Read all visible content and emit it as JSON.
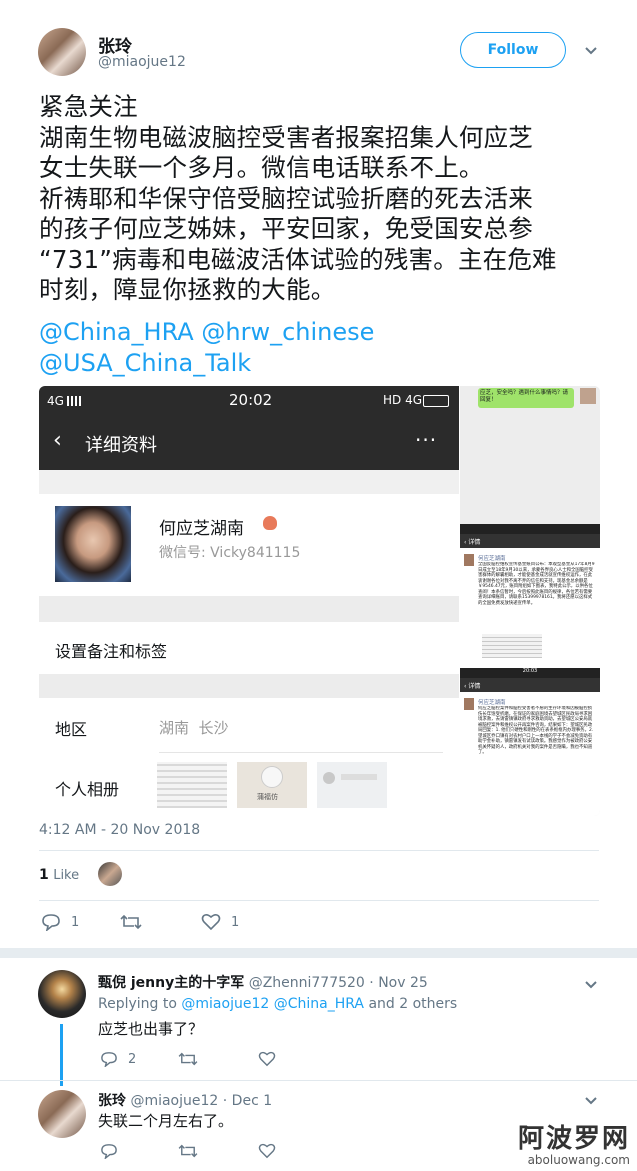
{
  "tweet": {
    "author_name": "张玲",
    "author_handle": "@miaojue12",
    "follow_label": "Follow",
    "text": "紧急关注\n湖南生物电磁波脑控受害者报案招集人何应芝\n女士失联一个多月。微信电话联系不上。\n祈祷耶和华保守倍受脑控试验折磨的死去活来\n的孩子何应芝姊妹，平安回家，免受国安总参\n“731”病毒和电磁波活体试验的残害。主在危难\n时刻，障显你拯救的大能。",
    "mentions": [
      "@China_HRA",
      "@hrw_chinese",
      "@USA_China_Talk"
    ],
    "timestamp": "4:12 AM - 20 Nov 2018",
    "likes_count": "1",
    "likes_label": "Like",
    "actions": {
      "reply_count": "1",
      "retweet_count": "",
      "like_count": "1"
    }
  },
  "screenshot_main": {
    "carrier": "4G",
    "time": "20:02",
    "status_right": "HD 4G",
    "nav_title": "详细资料",
    "contact_name": "何应芝湖南",
    "wechat_id": "微信号: Vicky841115",
    "remark_label": "设置备注和标签",
    "region_label": "地区",
    "region_value": "湖南  长沙",
    "album_label": "个人相册",
    "album_thumb_text": "蒲福仿"
  },
  "screenshot_side": {
    "bubble_text": "应芝，安全吗？遇到什么事情吗？请回复！",
    "header_title": "详情",
    "post_author": "何应芝湖南",
    "post1_text": "全国反脑控维权宣传基金账目公布：本观型基金从17年8月9日成立至18年9月30以来，承蒙各界良心人士和全国脑控受害群体的解囊相助，才能使基金成活就宣传维权运作，在此衷谢谢各位对我不离不弃的信任和支持。现基金总余额是￥9546.47元，账目附组如下图表，我特此公示，以供各位查阅！本条信暂时，今后按照此账目的规律，各位若有需要查询详细账目，请联系15399978161。我将还愿以这样式的全国免费发放快递宣传单。",
    "post2_text": "何应芝脑控案件和脑控受害者不愿的生存环境和因被脑控损伤长年饱受折磨，在保证的家庭困境去望城区民政局寻求困境求救，去请雷镇镇政府寻求救助资助，去望城区公安局就被脑控案件和维权公开再案件咨询，结果如下：望城区民政局回复：1. 他们只硬性和刚性的在表条框框内办理事务。2. 望城区乔口镇有对农村户口上一本线的学子不会减免资助有助学金补助，镇雷镇发有试读政策。我感觉作为被政府公安机关怀疑的人，政府机关对我的案件是否隐瞒，我也不知道了。",
    "time2": "20:03"
  },
  "reply1": {
    "name": "甄倪 jenny主的十字军",
    "handle": "@Zhenni777520",
    "date": "· Nov 25",
    "replying_prefix": "Replying to",
    "replying_to1": "@miaojue12",
    "replying_to2": "@China_HRA",
    "replying_suffix": "and 2 others",
    "text": "应芝也出事了？",
    "reply_count": "2"
  },
  "reply2": {
    "name": "张玲",
    "handle": "@miaojue12",
    "date": "· Dec 1",
    "text": "失联二个月左右了。"
  },
  "watermark": {
    "title": "阿波罗网",
    "url": "aboluowang.com"
  }
}
